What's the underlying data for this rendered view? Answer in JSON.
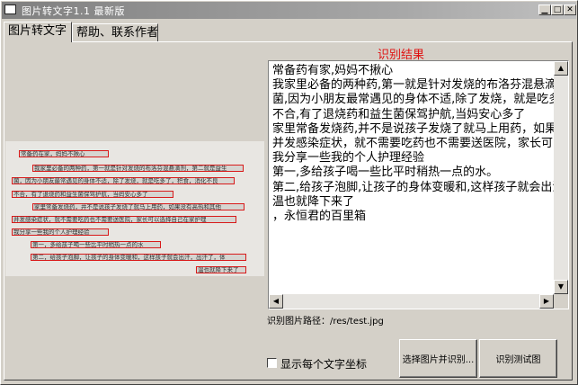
{
  "window": {
    "title": "图片转文字1.1    最新版"
  },
  "tabs": [
    {
      "label": "图片转文字"
    },
    {
      "label": "帮助、联系作者"
    }
  ],
  "result": {
    "title": "识别结果",
    "lines": [
      "常备药有家,妈妈不揪心",
      "我家里必备的两种药,第一就是针对发烧的布洛芬混悬滴剂",
      "菌,因为小朋友最常遇见的身体不适,除了发烧，就是吃多、",
      "不合,有了退烧药和益生菌保驾护航,当妈安心多了",
      "家里常备发烧药,并不是说孩子发烧了就马上用药，如果没",
      "并发感染症状，就不需要吃药也不需要送医院，家长可以",
      "我分享一些我的个人护理经验",
      "第一,多给孩子喝一些比平时稍热一点的水。",
      "第二,给孩子泡脚,让孩子的身体变暖和,这样孩子就会出汗,",
      "温也就降下来了",
      "，永恒君的百里箱"
    ]
  },
  "photo_lines": [
    "常备药在家，妈妈不揪心",
    "我家里必备的两种药，第一就是针对发烧的布洛芬混悬滴剂，第二就是益生",
    "菌，因为小朋友最常遇见的身体不适，除了发烧，就是吃多了，积食，消化不良",
    "不合，有了退烧药和益生菌保驾护航，当妈安心多了",
    "家里常备发烧药，并不是说孩子发烧了就马上用药，如果没有高热和其他",
    "并发感染症状，就不需要吃药也不需要送医院，家长可以选择自己在家护理",
    "我分享一些我的个人护理经验",
    "第一，多给孩子喝一些比平时稍热一点的水",
    "第二，给孩子泡脚，让孩子的身体变暖和，这样孩子就会出汗，出汗了，体",
    "温也就降下来了"
  ],
  "image_path": {
    "label": "识别图片路径：/res/test.jpg"
  },
  "checkbox": {
    "label": "显示每个文字坐标",
    "checked": false
  },
  "buttons": {
    "select_label": "选择图片并识别...",
    "test_label": "识别测试图"
  }
}
